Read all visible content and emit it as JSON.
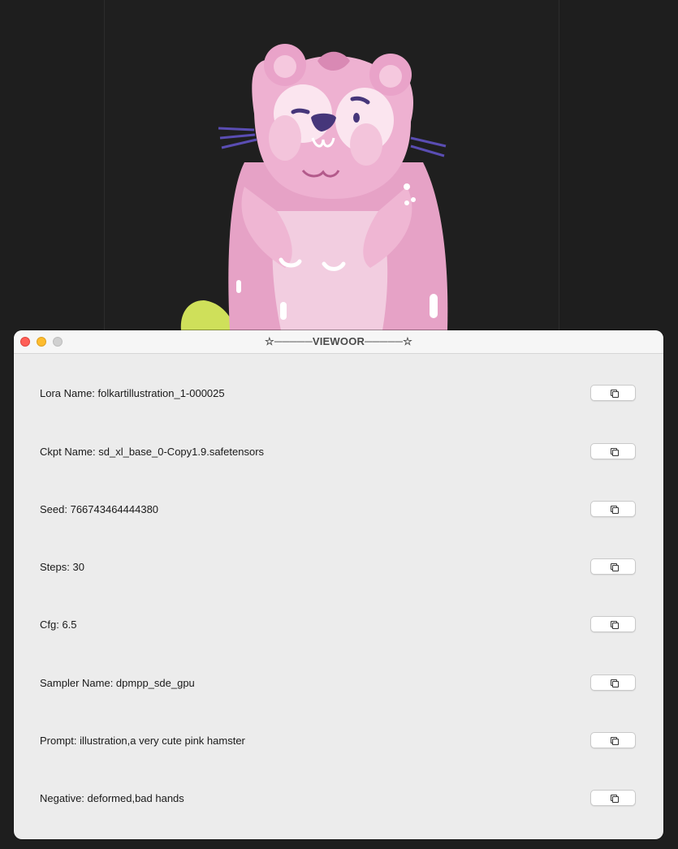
{
  "window": {
    "title": "☆─────VIEWOOR─────☆"
  },
  "rows": [
    {
      "label": "Lora Name: folkartillustration_1-000025",
      "copy_icon": "copy-icon"
    },
    {
      "label": "Ckpt Name: sd_xl_base_0-Copy1.9.safetensors",
      "copy_icon": "copy-icon"
    },
    {
      "label": "Seed: 766743464444380",
      "copy_icon": "copy-icon"
    },
    {
      "label": "Steps: 30",
      "copy_icon": "copy-icon"
    },
    {
      "label": "Cfg: 6.5",
      "copy_icon": "copy-icon"
    },
    {
      "label": "Sampler Name: dpmpp_sde_gpu",
      "copy_icon": "copy-icon"
    },
    {
      "label": "Prompt: illustration,a very cute pink hamster",
      "copy_icon": "copy-icon"
    },
    {
      "label": "Negative: deformed,bad hands",
      "copy_icon": "copy-icon"
    }
  ],
  "colors": {
    "backdrop": "#1e1e1e",
    "window_bg": "#ececec",
    "close": "#ff5f57",
    "minimize": "#febc2e",
    "zoom_disabled": "#d0d0d0",
    "hamster_pink": "#e9a3c9"
  }
}
